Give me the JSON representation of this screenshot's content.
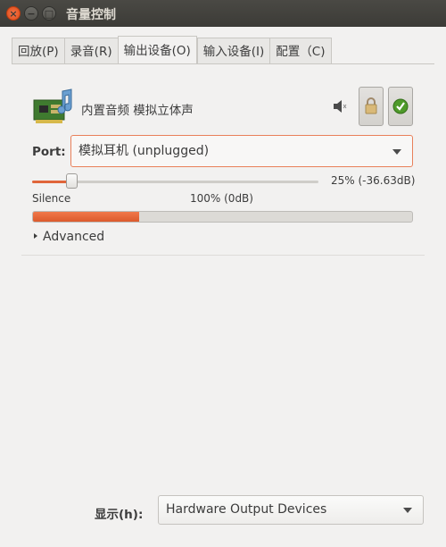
{
  "window": {
    "title": "音量控制",
    "close_glyph": "×",
    "min_glyph": "−",
    "max_glyph": "□"
  },
  "tabs": [
    {
      "label": "回放(P)"
    },
    {
      "label": "录音(R)"
    },
    {
      "label": "输出设备(O)",
      "active": true
    },
    {
      "label": "输入设备(I)"
    },
    {
      "label": "配置（C)"
    }
  ],
  "device": {
    "name": "内置音频 模拟立体声",
    "icon": "sound-card-icon",
    "mute_icon": "speaker-muted-icon",
    "lock_icon": "lock-icon",
    "default_icon": "check-circle-icon"
  },
  "port": {
    "label": "Port:",
    "value": "模拟耳机 (unplugged)"
  },
  "volume": {
    "percent": 25,
    "readout": "25% (-36.63dB)",
    "silence_label": "Silence",
    "hundred_label": "100% (0dB)"
  },
  "meter": {
    "level_fraction": 0.28
  },
  "advanced": {
    "label": "Advanced"
  },
  "footer": {
    "show_label": "显示(h):",
    "show_value": "Hardware Output Devices"
  },
  "colors": {
    "accent": "#e0653a",
    "titlebar": "#3c3b37"
  }
}
